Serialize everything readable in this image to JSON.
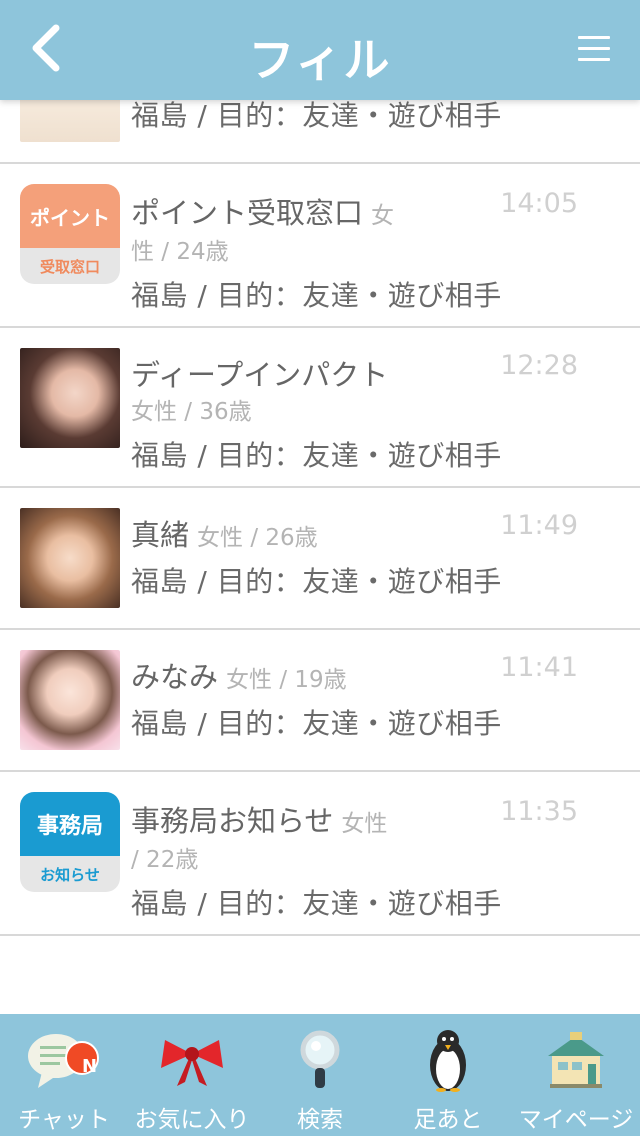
{
  "header": {
    "title": "フィル",
    "back_icon": "chevron-left-icon",
    "menu_icon": "hamburger-menu-icon"
  },
  "colors": {
    "header_bg": "#8ec5db",
    "point_badge": "#f4a07a",
    "office_badge": "#1a9bd1",
    "text_primary": "#666666",
    "text_muted": "#b4b4b4"
  },
  "list": [
    {
      "partial": true,
      "purpose": "福島 / 目的：友達・遊び相手"
    },
    {
      "name": "ポイント受取窓口",
      "gender_age_a": "女",
      "gender_age_b": "性 / 24歳",
      "purpose": "福島 / 目的：友達・遊び相手",
      "time": "14:05",
      "badge_top": "ポイント",
      "badge_bottom": "受取窓口"
    },
    {
      "name": "ディープインパクト",
      "gender_age": "女性 / 36歳",
      "purpose": "福島 / 目的：友達・遊び相手",
      "time": "12:28"
    },
    {
      "name": "真緒",
      "gender_age": "女性 / 26歳",
      "purpose": "福島 / 目的：友達・遊び相手",
      "time": "11:49"
    },
    {
      "name": "みなみ",
      "gender_age": "女性 / 19歳",
      "purpose": "福島 / 目的：友達・遊び相手",
      "time": "11:41"
    },
    {
      "name": "事務局お知らせ",
      "gender_age_a": "女性",
      "gender_age_b": "/ 22歳",
      "purpose": "福島 / 目的：友達・遊び相手",
      "time": "11:35",
      "badge_top": "事務局",
      "badge_bottom": "お知らせ"
    }
  ],
  "tabbar": {
    "tabs": [
      {
        "label": "チャット",
        "icon": "chat-bubble-icon",
        "badge": "N"
      },
      {
        "label": "お気に入り",
        "icon": "ribbon-icon"
      },
      {
        "label": "検索",
        "icon": "magnifier-icon"
      },
      {
        "label": "足あと",
        "icon": "penguin-icon"
      },
      {
        "label": "マイページ",
        "icon": "house-icon"
      }
    ]
  }
}
